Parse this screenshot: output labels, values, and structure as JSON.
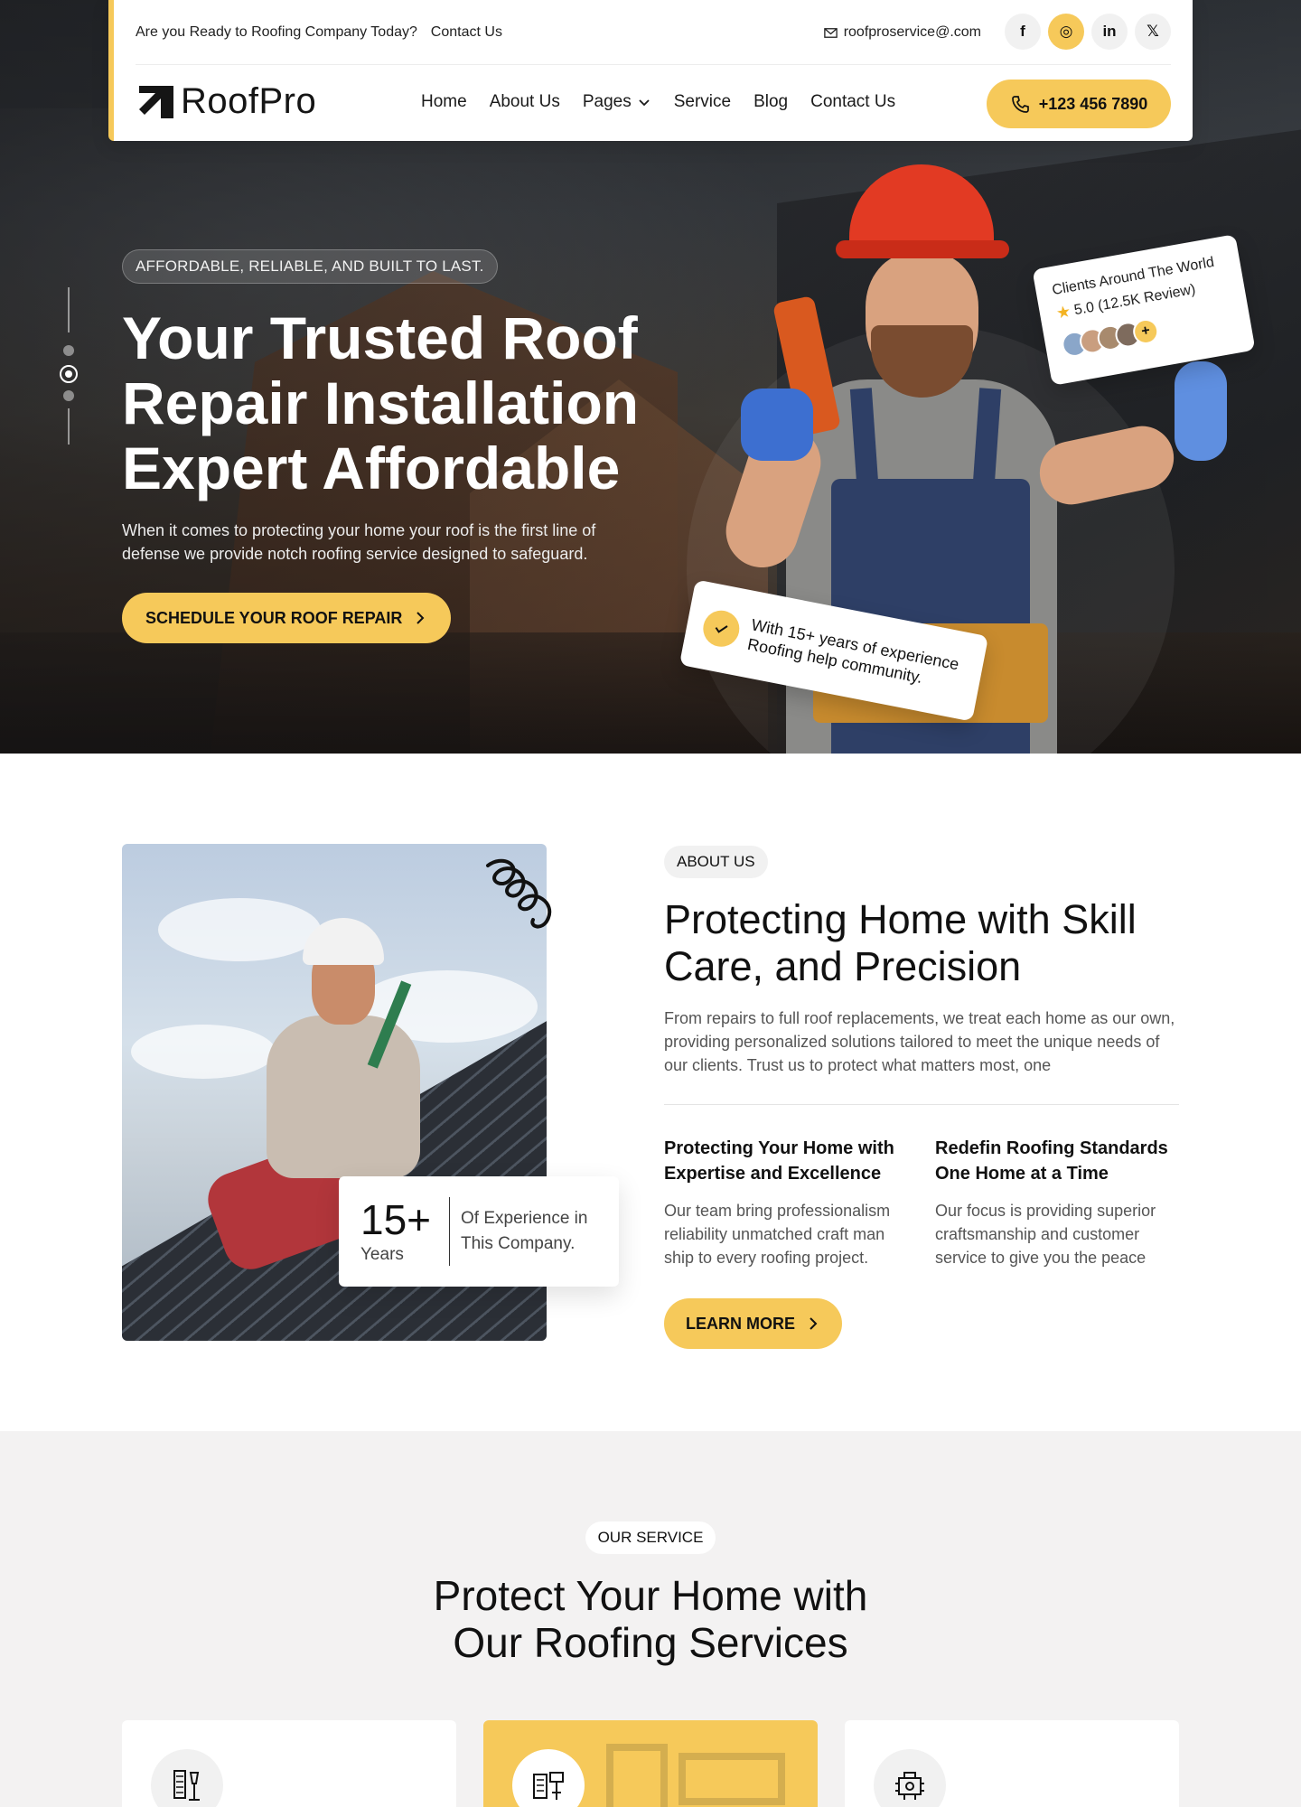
{
  "topbar": {
    "ready_text": "Are you Ready to Roofing Company Today?",
    "contact_link": "Contact Us",
    "email": "roofproservice@.com",
    "socials": [
      {
        "icon": "facebook-icon",
        "glyph": "f"
      },
      {
        "icon": "instagram-icon",
        "glyph": "◎",
        "active": true
      },
      {
        "icon": "linkedin-icon",
        "glyph": "in"
      },
      {
        "icon": "x-icon",
        "glyph": "𝕏"
      }
    ]
  },
  "nav": {
    "logo_text": "RoofPro",
    "items": [
      "Home",
      "About Us",
      "Pages",
      "Service",
      "Blog",
      "Contact Us"
    ],
    "phone": "+123 456 7890"
  },
  "hero": {
    "tag": "AFFORDABLE, RELIABLE, AND BUILT TO LAST.",
    "title": "Your Trusted Roof Repair Installation Expert Affordable",
    "description": "When it comes to protecting your home your roof is the first line of defense we provide notch roofing service designed to safeguard.",
    "cta": "SCHEDULE YOUR ROOF REPAIR",
    "slide_count": 3,
    "active_slide": 2,
    "clients_card": {
      "title": "Clients Around The World",
      "rating": "5.0 (12.5K Review)",
      "more_glyph": "+"
    },
    "experience_card": "With 15+ years of experience Roofing help community."
  },
  "about": {
    "tag": "ABOUT US",
    "title": "Protecting Home with Skill Care, and Precision",
    "description": "From repairs to full roof replacements, we treat each home as our own, providing personalized solutions tailored to meet the unique needs of our clients. Trust us to protect what matters most, one",
    "experience_number": "15+",
    "experience_unit": "Years",
    "experience_desc": "Of Experience in This Company.",
    "features": [
      {
        "title": "Protecting Your Home with Expertise and Excellence",
        "text": "Our team bring professionalism reliability unmatched craft man ship to every roofing project."
      },
      {
        "title": "Redefin Roofing Standards One Home at a Time",
        "text": "Our focus is providing superior craftsmanship and customer service to give you the peace"
      }
    ],
    "cta": "LEARN MORE"
  },
  "services": {
    "tag": "OUR SERVICE",
    "title_line1": "Protect Your Home with",
    "title_line2": "Our Roofing Services",
    "cards": [
      {
        "icon": "drill-tools-icon",
        "highlighted": false
      },
      {
        "icon": "toolbox-icon",
        "highlighted": true
      },
      {
        "icon": "roof-machine-icon",
        "highlighted": false
      }
    ]
  },
  "colors": {
    "accent": "#f6c95a",
    "text_dark": "#111111",
    "section_bg": "#f3f2f2"
  }
}
